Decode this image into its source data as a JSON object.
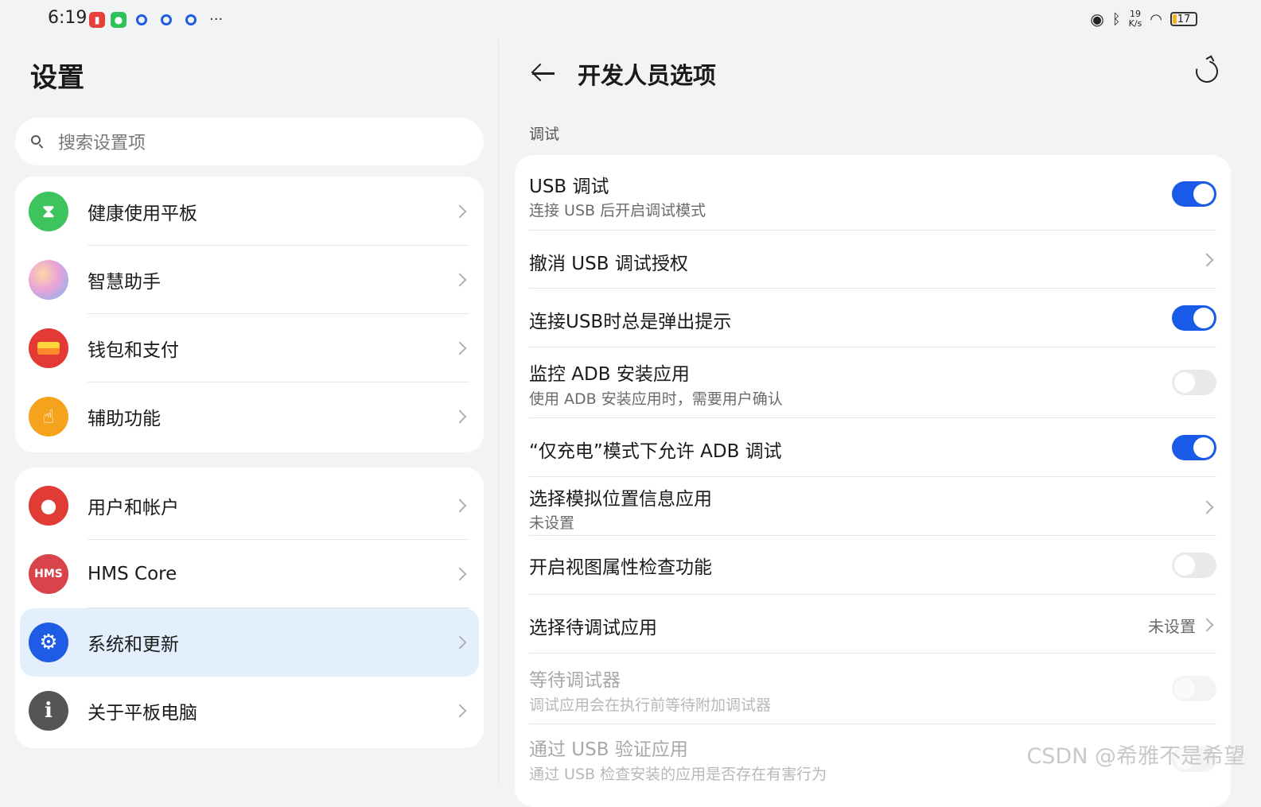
{
  "status_bar": {
    "time": "6:19",
    "net_speed_value": "19",
    "net_speed_unit": "K/s",
    "battery": "17",
    "battery_level": 0.17,
    "icons": [
      "battery-saver-icon",
      "wechat-icon",
      "ring-icon",
      "ring-icon",
      "ring-icon",
      "more-dots-icon",
      "eye-icon",
      "bluetooth-icon",
      "wifi-icon",
      "battery-icon"
    ]
  },
  "left": {
    "title": "设置",
    "search_placeholder": "搜索设置项",
    "group1": [
      {
        "label": "健康使用平板",
        "icon": "hourglass-icon",
        "color": "#3dc45c"
      },
      {
        "label": "智慧助手",
        "icon": "assistant-icon",
        "color": "#c7a8ea"
      },
      {
        "label": "钱包和支付",
        "icon": "wallet-icon",
        "color": "#e33a36"
      },
      {
        "label": "辅助功能",
        "icon": "hand-icon",
        "color": "#f5a21c"
      }
    ],
    "group2": [
      {
        "label": "用户和帐户",
        "icon": "user-icon",
        "color": "#e03b35"
      },
      {
        "label": "HMS Core",
        "icon": "hms-icon",
        "icon_text": "HMS",
        "color": "#d9434a"
      },
      {
        "label": "系统和更新",
        "icon": "gear-icon",
        "color": "#1e5ce6"
      },
      {
        "label": "关于平板电脑",
        "icon": "info-icon",
        "color": "#555555"
      }
    ]
  },
  "right": {
    "title": "开发人员选项",
    "section": "调试",
    "rows": [
      {
        "title": "USB 调试",
        "subtitle": "连接 USB 后开启调试模式",
        "control": "toggle",
        "state": "on"
      },
      {
        "title": "撤消 USB 调试授权",
        "control": "chevron"
      },
      {
        "title": "连接USB时总是弹出提示",
        "control": "toggle",
        "state": "on"
      },
      {
        "title": "监控 ADB 安装应用",
        "subtitle": "使用 ADB 安装应用时，需要用户确认",
        "control": "toggle",
        "state": "off"
      },
      {
        "title": "“仅充电”模式下允许 ADB 调试",
        "control": "toggle",
        "state": "on"
      },
      {
        "title": "选择模拟位置信息应用",
        "subtitle": "未设置",
        "control": "chevron"
      },
      {
        "title": "开启视图属性检查功能",
        "control": "toggle",
        "state": "off"
      },
      {
        "title": "选择待调试应用",
        "value": "未设置",
        "control": "chevron"
      },
      {
        "title": "等待调试器",
        "subtitle": "调试应用会在执行前等待附加调试器",
        "control": "toggle",
        "state": "disabled"
      },
      {
        "title": "通过 USB 验证应用",
        "subtitle": "通过 USB 检查安装的应用是否存在有害行为",
        "control": "toggle",
        "state": "disabled"
      }
    ]
  },
  "watermark": "CSDN @希雅不是希望",
  "colors": {
    "accent": "#1a5ae8",
    "selected_bg": "#e3effd",
    "page_bg": "#f1f3f5"
  }
}
